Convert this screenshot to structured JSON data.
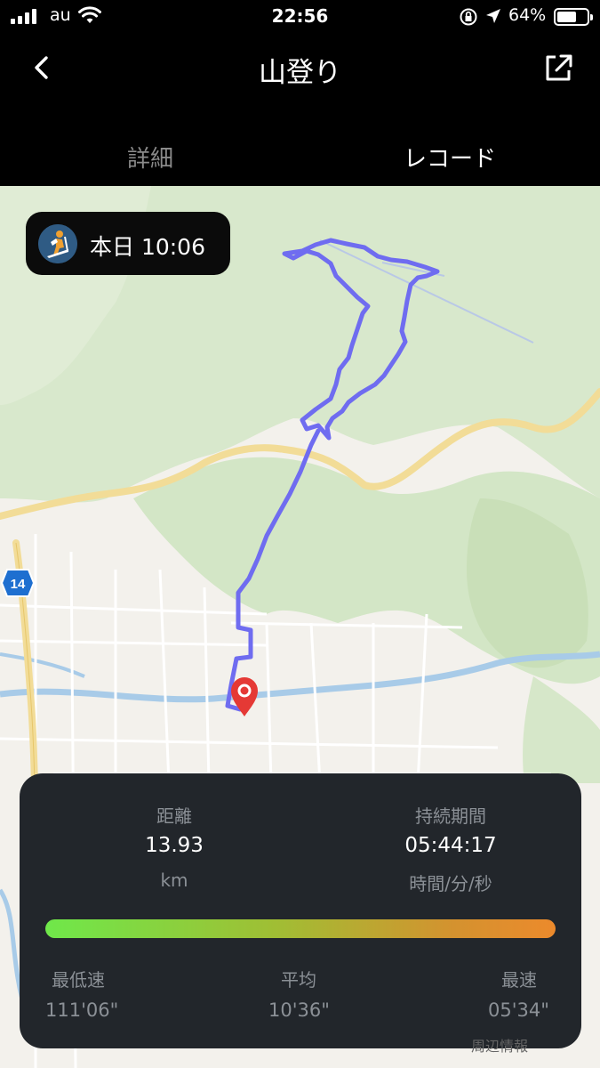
{
  "status_bar": {
    "carrier": "au",
    "time": "22:56",
    "battery_pct": "64%",
    "battery_level": 0.64
  },
  "nav": {
    "title": "山登り"
  },
  "tabs": [
    {
      "label": "詳細",
      "selected": false
    },
    {
      "label": "レコード",
      "selected": true
    }
  ],
  "activity_chip": {
    "text": "本日 10:06"
  },
  "map": {
    "route_color": "#6f6cf0",
    "road_sign": "14",
    "attribution": "周辺情報"
  },
  "stats": {
    "distance": {
      "label": "距離",
      "value": "13.93",
      "unit": "km"
    },
    "duration": {
      "label": "持続期間",
      "value": "05:44:17",
      "unit": "時間/分/秒"
    }
  },
  "speed": {
    "min": {
      "label": "最低速",
      "value": "111'06\""
    },
    "avg": {
      "label": "平均",
      "value": "10'36\""
    },
    "max": {
      "label": "最速",
      "value": "05'34\""
    },
    "gradient_colors": [
      "#6fe84a",
      "#ec8a2c"
    ]
  }
}
